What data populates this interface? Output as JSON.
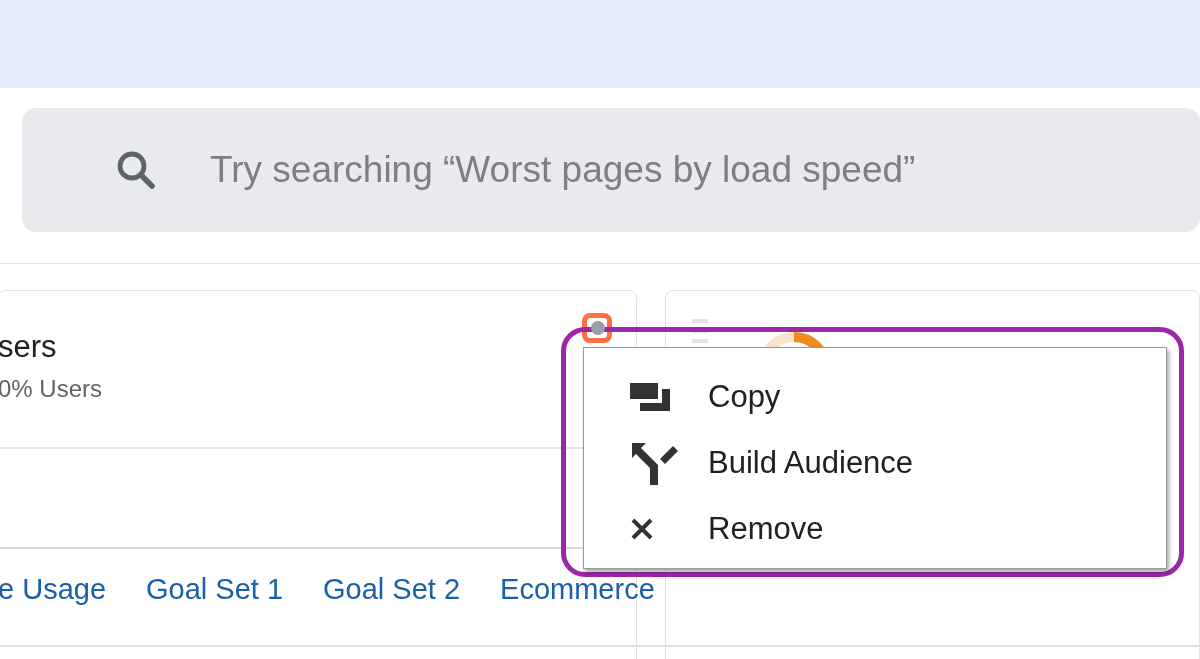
{
  "search": {
    "placeholder": "Try searching “Worst pages by load speed”"
  },
  "cards": [
    {
      "title": "sers",
      "subtitle": "0% Users"
    }
  ],
  "tabs": [
    {
      "label": "e Usage"
    },
    {
      "label": "Goal Set 1"
    },
    {
      "label": "Goal Set 2"
    },
    {
      "label": "Ecommerce"
    }
  ],
  "menu": {
    "items": [
      {
        "kind": "copy",
        "label": "Copy"
      },
      {
        "kind": "audience",
        "label": "Build Audience"
      },
      {
        "kind": "remove",
        "label": "Remove"
      }
    ]
  }
}
